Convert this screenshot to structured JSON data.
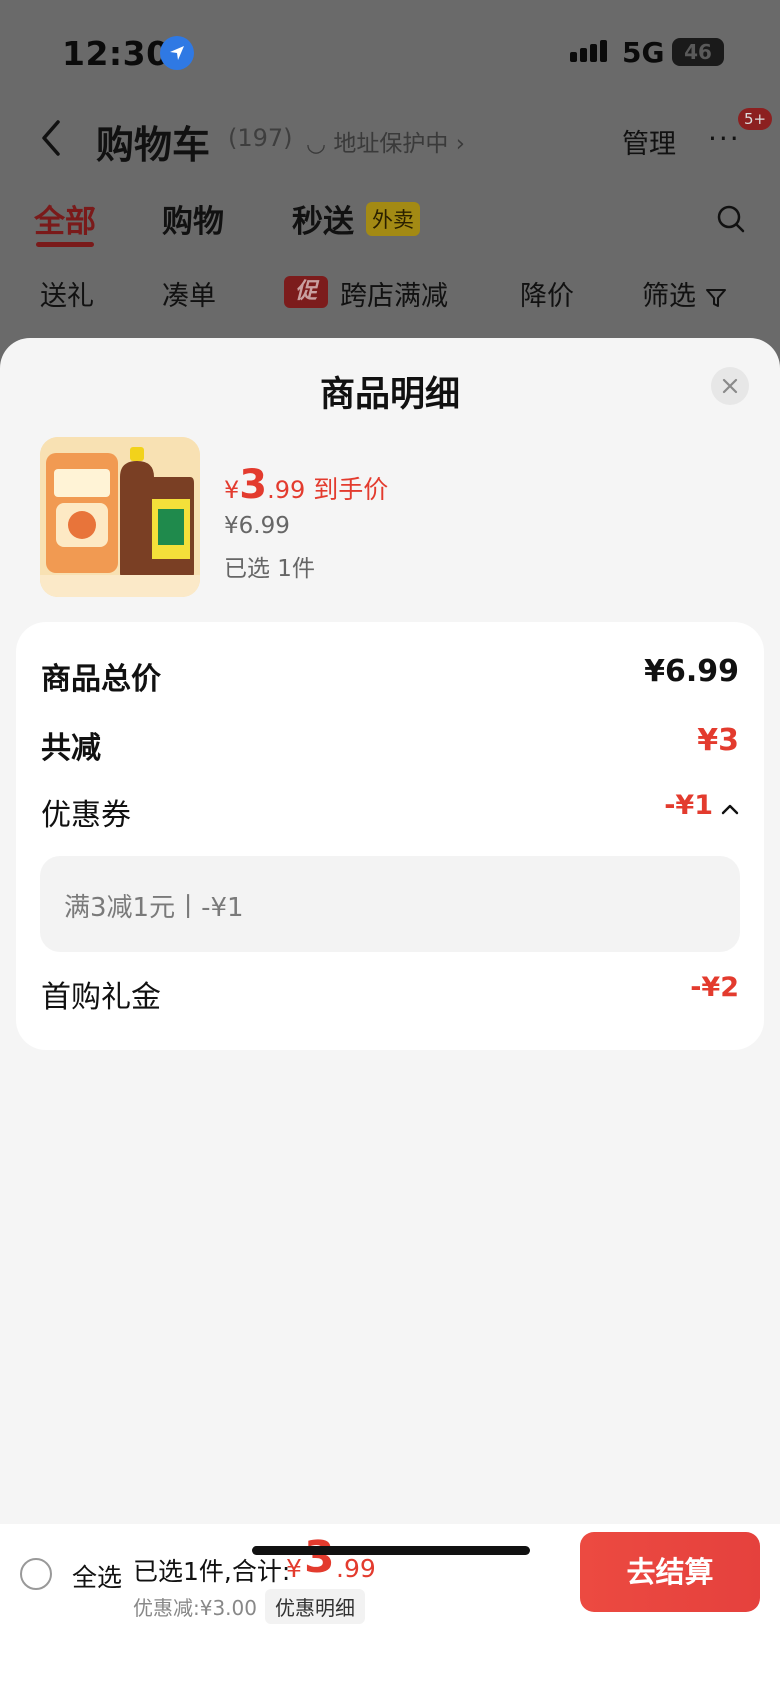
{
  "status_bar": {
    "time": "12:30",
    "network": "5G",
    "battery": "46"
  },
  "header": {
    "title": "购物车",
    "count": "(197)",
    "address": "地址保护中",
    "manage": "管理",
    "more": "···",
    "badge": "5+"
  },
  "tabs": [
    {
      "label": "全部",
      "active": true
    },
    {
      "label": "购物",
      "active": false
    },
    {
      "label": "秒送",
      "active": false,
      "tag": "外卖"
    }
  ],
  "filters": [
    {
      "label": "送礼"
    },
    {
      "label": "凑单"
    },
    {
      "label": "跨店满减",
      "badge": "促"
    },
    {
      "label": "降价"
    },
    {
      "label": "筛选"
    }
  ],
  "sheet": {
    "title": "商品明细",
    "product": {
      "yen": "¥",
      "price_int": "3",
      "price_dec": ".99",
      "price_label": "到手价",
      "original_price": "¥6.99",
      "selected": "已选 1件"
    },
    "breakdown": {
      "total_label": "商品总价",
      "total_value": "¥6.99",
      "saved_label": "共减",
      "saved_value": "¥3",
      "coupon_label": "优惠券",
      "coupon_value": "-¥1",
      "coupon_detail": "满3减1元丨-¥1",
      "gift_label": "首购礼金",
      "gift_value": "-¥2"
    }
  },
  "bottom_bar": {
    "select_all": "全选",
    "total_label": "已选1件,合计:",
    "yen": "¥",
    "total_int": "3",
    "total_dec": ".99",
    "discount": "优惠减:¥3.00",
    "detail_button": "优惠明细",
    "checkout_button": "去结算"
  },
  "colors": {
    "accent_red": "#e33b2e",
    "sheet_bg": "#f5f5f5"
  }
}
